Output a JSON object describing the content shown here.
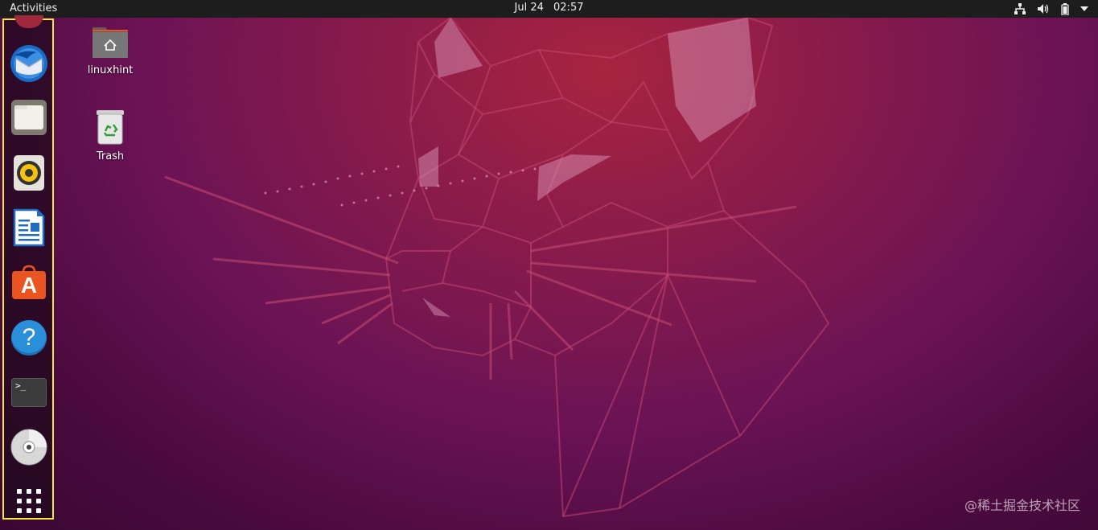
{
  "topbar": {
    "activities_label": "Activities",
    "date": "Jul 24",
    "time": "02:57",
    "tray_icons": [
      "network-icon",
      "volume-icon",
      "battery-icon",
      "system-menu-arrow-icon"
    ]
  },
  "dock": {
    "items": [
      {
        "name": "thunderbird",
        "icon": "thunderbird-mail-icon"
      },
      {
        "name": "files",
        "icon": "files-folder-icon"
      },
      {
        "name": "rhythmbox",
        "icon": "rhythmbox-speaker-icon"
      },
      {
        "name": "libreoffice-writer",
        "icon": "writer-document-icon"
      },
      {
        "name": "ubuntu-software",
        "icon": "software-store-icon"
      },
      {
        "name": "help",
        "icon": "help-question-icon"
      },
      {
        "name": "terminal",
        "icon": "terminal-icon",
        "prompt": ">_"
      },
      {
        "name": "disc",
        "icon": "optical-disc-icon"
      },
      {
        "name": "show-applications",
        "icon": "app-grid-icon"
      }
    ],
    "help_glyph": "?",
    "software_glyph": "A"
  },
  "desktop": {
    "icons": [
      {
        "label": "linuxhint",
        "icon": "home-folder-icon"
      },
      {
        "label": "Trash",
        "icon": "trash-icon"
      }
    ]
  },
  "watermark": "@稀土掘金技术社区",
  "colors": {
    "topbar_bg": "#1d1d1d",
    "dock_highlight": "#f4e640",
    "wallpaper_top": "#a8243f",
    "wallpaper_bottom": "#3a0834",
    "software_orange": "#e95420",
    "help_blue": "#2a8fd8"
  }
}
